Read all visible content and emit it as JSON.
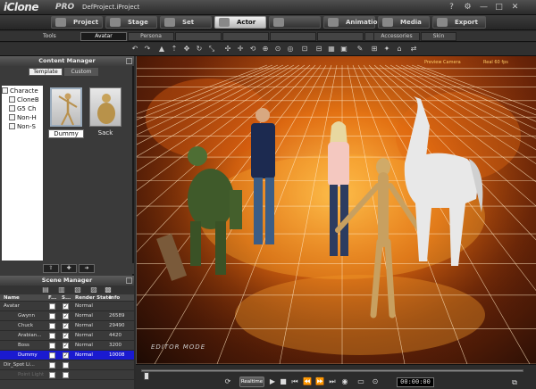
{
  "titlebar": {
    "logo": "iClone",
    "edition": "PRO",
    "project": "DefProject.iProject"
  },
  "main_tabs": [
    {
      "label": "Project",
      "state": "normal"
    },
    {
      "label": "Stage",
      "state": "normal"
    },
    {
      "label": "Set",
      "state": "normal"
    },
    {
      "label": "Actor",
      "state": "active"
    },
    {
      "label": "Animation",
      "state": "normal"
    },
    {
      "label": "Media",
      "state": "normal"
    },
    {
      "label": "Export",
      "state": "normal"
    }
  ],
  "subtabs": {
    "tools_label": "Tools",
    "items": [
      {
        "label": "Avatar",
        "state": "active"
      },
      {
        "label": "Persona",
        "state": "normal"
      },
      {
        "label": "",
        "state": "disabled"
      },
      {
        "label": "",
        "state": "disabled"
      },
      {
        "label": "",
        "state": "disabled"
      },
      {
        "label": "",
        "state": "disabled"
      },
      {
        "label": "",
        "state": "disabled"
      },
      {
        "label": "Accessories",
        "state": "normal"
      },
      {
        "label": "Skin",
        "state": "normal"
      }
    ]
  },
  "content_manager": {
    "title": "Content Manager",
    "tabs": [
      {
        "label": "Template",
        "active": true
      },
      {
        "label": "Custom",
        "active": false
      }
    ],
    "tree": [
      "Characte",
      "CloneB",
      "G5 Ch",
      "Non-H",
      "Non-S"
    ],
    "thumbnails": [
      {
        "label": "Dummy",
        "selected": true
      },
      {
        "label": "Sack",
        "selected": false
      }
    ]
  },
  "scene_manager": {
    "title": "Scene Manager",
    "columns": [
      "Name",
      "F...",
      "S...",
      "Render State",
      "Info"
    ],
    "rows": [
      {
        "name": "Avatar",
        "f": false,
        "s": true,
        "render": "Normal",
        "info": "",
        "group": true,
        "selected": false,
        "disabled": false
      },
      {
        "name": "Gwynn",
        "f": false,
        "s": true,
        "render": "Normal",
        "info": "26589",
        "group": false,
        "selected": false,
        "disabled": false
      },
      {
        "name": "Chuck",
        "f": false,
        "s": true,
        "render": "Normal",
        "info": "29490",
        "group": false,
        "selected": false,
        "disabled": false
      },
      {
        "name": "Arabian...",
        "f": false,
        "s": true,
        "render": "Normal",
        "info": "4420",
        "group": false,
        "selected": false,
        "disabled": false
      },
      {
        "name": "Boss",
        "f": false,
        "s": true,
        "render": "Normal",
        "info": "3200",
        "group": false,
        "selected": false,
        "disabled": false
      },
      {
        "name": "Dummy",
        "f": false,
        "s": true,
        "render": "Normal",
        "info": "10008",
        "group": false,
        "selected": true,
        "disabled": false
      },
      {
        "name": "Dir_Spot Li...",
        "f": false,
        "s": false,
        "render": "",
        "info": "",
        "group": true,
        "selected": false,
        "disabled": false
      },
      {
        "name": "Point Light",
        "f": false,
        "s": false,
        "render": "",
        "info": "",
        "group": false,
        "selected": false,
        "disabled": true
      }
    ]
  },
  "viewport": {
    "label_left": "Preview Camera",
    "label_right": "Real 60 fps",
    "mode": "EDITOR MODE"
  },
  "playback": {
    "realtime_label": "Realtime",
    "timecode": "00:00:00",
    "position": 0
  }
}
